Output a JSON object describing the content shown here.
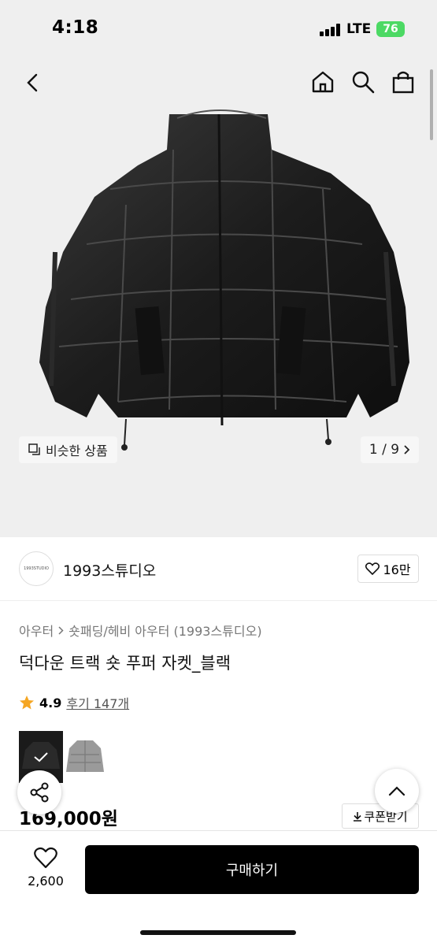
{
  "status": {
    "time": "4:18",
    "network": "LTE",
    "battery": "76"
  },
  "nav": {
    "back_icon": "chevron-left-icon",
    "home_icon": "home-icon",
    "search_icon": "search-icon",
    "bag_icon": "shopping-bag-icon"
  },
  "gallery": {
    "similar_label": "비슷한 상품",
    "pager": "1 / 9"
  },
  "brand": {
    "logo_text": "1993STUDIO",
    "name": "1993스튜디오",
    "likes": "16만"
  },
  "breadcrumb": {
    "level1": "아우터",
    "level2": "숏패딩/헤비 아우터 (1993스튜디오)"
  },
  "product": {
    "title": "덕다운 트랙 숏 푸퍼 자켓_블랙",
    "rating": "4.9",
    "reviews": "후기 147개",
    "price": "169,000원",
    "coupon_label": "쿠폰받기"
  },
  "bottom": {
    "favorites": "2,600",
    "buy_label": "구매하기"
  },
  "colors": {
    "accent": "#000000",
    "star": "#f5a623",
    "battery": "#4cd964"
  }
}
